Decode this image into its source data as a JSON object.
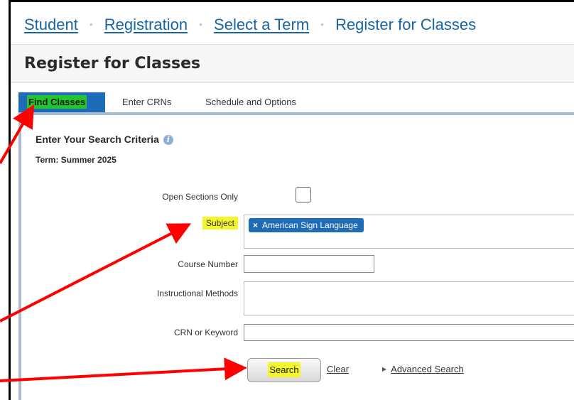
{
  "breadcrumb": {
    "items": [
      "Student",
      "Registration",
      "Select a Term",
      "Register for Classes"
    ],
    "separator": "•"
  },
  "page": {
    "title": "Register for Classes"
  },
  "tabs": [
    "Find Classes",
    "Enter CRNs",
    "Schedule and Options"
  ],
  "search": {
    "title": "Enter Your Search Criteria",
    "info_icon": "i",
    "term": "Term: Summer 2025"
  },
  "form": {
    "open_sections_label": "Open Sections Only",
    "subject_label": "Subject",
    "subject_chip": "American Sign Language",
    "subject_chip_remove": "×",
    "course_number_label": "Course Number",
    "instructional_methods_label": "Instructional Methods",
    "crn_keyword_label": "CRN or Keyword"
  },
  "actions": {
    "search": "Search",
    "clear": "Clear",
    "advanced_search": "Advanced Search",
    "advanced_icon": "▶"
  },
  "colors": {
    "link": "#1565a8",
    "active_tab": "#1e6bb8",
    "highlight_green": "#22c52c",
    "highlight_yellow": "#f5f52d",
    "arrow": "#ff0000"
  }
}
